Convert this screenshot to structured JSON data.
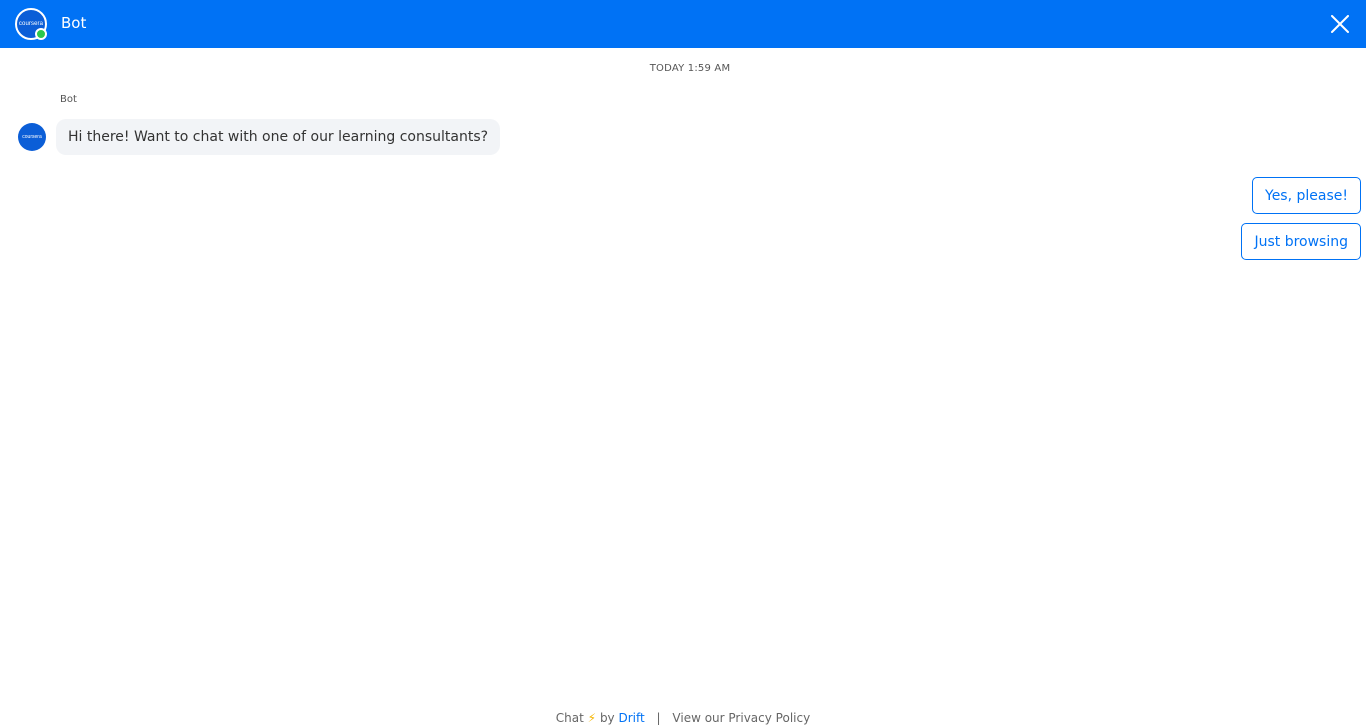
{
  "header": {
    "title": "Bot",
    "avatar_logo": "coursera",
    "status_color": "#2cc84d",
    "background_color": "#0072f5",
    "close_icon": "close-icon"
  },
  "conversation": {
    "timestamp": "TODAY 1:59 AM",
    "sender": "Bot",
    "avatar_logo": "coursera",
    "message": "Hi there! Want to chat with one of our learning consultants?"
  },
  "quick_replies": [
    {
      "label": "Yes, please!"
    },
    {
      "label": "Just browsing"
    }
  ],
  "footer": {
    "chat_label": "Chat",
    "bolt_icon": "lightning-bolt-icon",
    "by_label": "by",
    "brand_link": "Drift",
    "separator": "|",
    "privacy_link": "View our Privacy Policy"
  }
}
